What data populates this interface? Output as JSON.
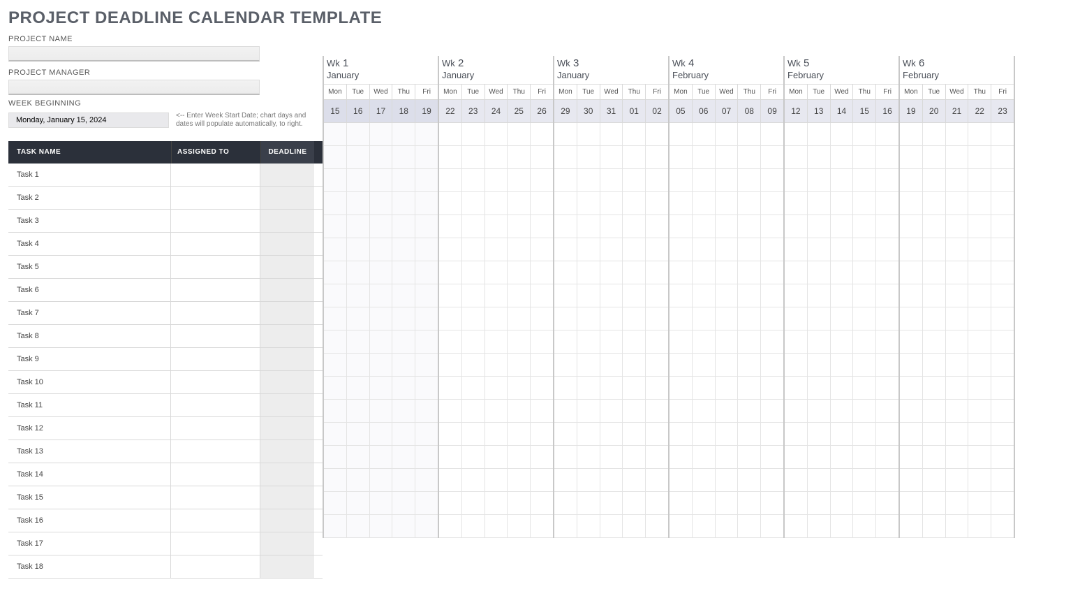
{
  "title": "PROJECT DEADLINE CALENDAR TEMPLATE",
  "fields": {
    "project_name_label": "PROJECT NAME",
    "project_name_value": "",
    "project_manager_label": "PROJECT MANAGER",
    "project_manager_value": "",
    "week_beginning_label": "WEEK BEGINNING",
    "week_beginning_value": "Monday, January 15, 2024",
    "week_beginning_hint": "<-- Enter Week Start Date; chart days and dates will populate automatically, to right."
  },
  "columns": {
    "task_name": "TASK NAME",
    "assigned_to": "ASSIGNED TO",
    "deadline": "DEADLINE"
  },
  "wk_prefix": "Wk",
  "weeks": [
    {
      "num": "1",
      "month": "January",
      "dow": [
        "Mon",
        "Tue",
        "Wed",
        "Thu",
        "Fri"
      ],
      "days": [
        "15",
        "16",
        "17",
        "18",
        "19"
      ]
    },
    {
      "num": "2",
      "month": "January",
      "dow": [
        "Mon",
        "Tue",
        "Wed",
        "Thu",
        "Fri"
      ],
      "days": [
        "22",
        "23",
        "24",
        "25",
        "26"
      ]
    },
    {
      "num": "3",
      "month": "January",
      "dow": [
        "Mon",
        "Tue",
        "Wed",
        "Thu",
        "Fri"
      ],
      "days": [
        "29",
        "30",
        "31",
        "01",
        "02"
      ]
    },
    {
      "num": "4",
      "month": "February",
      "dow": [
        "Mon",
        "Tue",
        "Wed",
        "Thu",
        "Fri"
      ],
      "days": [
        "05",
        "06",
        "07",
        "08",
        "09"
      ]
    },
    {
      "num": "5",
      "month": "February",
      "dow": [
        "Mon",
        "Tue",
        "Wed",
        "Thu",
        "Fri"
      ],
      "days": [
        "12",
        "13",
        "14",
        "15",
        "16"
      ]
    },
    {
      "num": "6",
      "month": "February",
      "dow": [
        "Mon",
        "Tue",
        "Wed",
        "Thu",
        "Fri"
      ],
      "days": [
        "19",
        "20",
        "21",
        "22",
        "23"
      ]
    }
  ],
  "tasks": [
    {
      "name": "Task 1",
      "assigned": "",
      "deadline": ""
    },
    {
      "name": "Task 2",
      "assigned": "",
      "deadline": ""
    },
    {
      "name": "Task 3",
      "assigned": "",
      "deadline": ""
    },
    {
      "name": "Task 4",
      "assigned": "",
      "deadline": ""
    },
    {
      "name": "Task 5",
      "assigned": "",
      "deadline": ""
    },
    {
      "name": "Task 6",
      "assigned": "",
      "deadline": ""
    },
    {
      "name": "Task 7",
      "assigned": "",
      "deadline": ""
    },
    {
      "name": "Task 8",
      "assigned": "",
      "deadline": ""
    },
    {
      "name": "Task 9",
      "assigned": "",
      "deadline": ""
    },
    {
      "name": "Task 10",
      "assigned": "",
      "deadline": ""
    },
    {
      "name": "Task 11",
      "assigned": "",
      "deadline": ""
    },
    {
      "name": "Task 12",
      "assigned": "",
      "deadline": ""
    },
    {
      "name": "Task 13",
      "assigned": "",
      "deadline": ""
    },
    {
      "name": "Task 14",
      "assigned": "",
      "deadline": ""
    },
    {
      "name": "Task 15",
      "assigned": "",
      "deadline": ""
    },
    {
      "name": "Task 16",
      "assigned": "",
      "deadline": ""
    },
    {
      "name": "Task 17",
      "assigned": "",
      "deadline": ""
    },
    {
      "name": "Task 18",
      "assigned": "",
      "deadline": ""
    }
  ]
}
